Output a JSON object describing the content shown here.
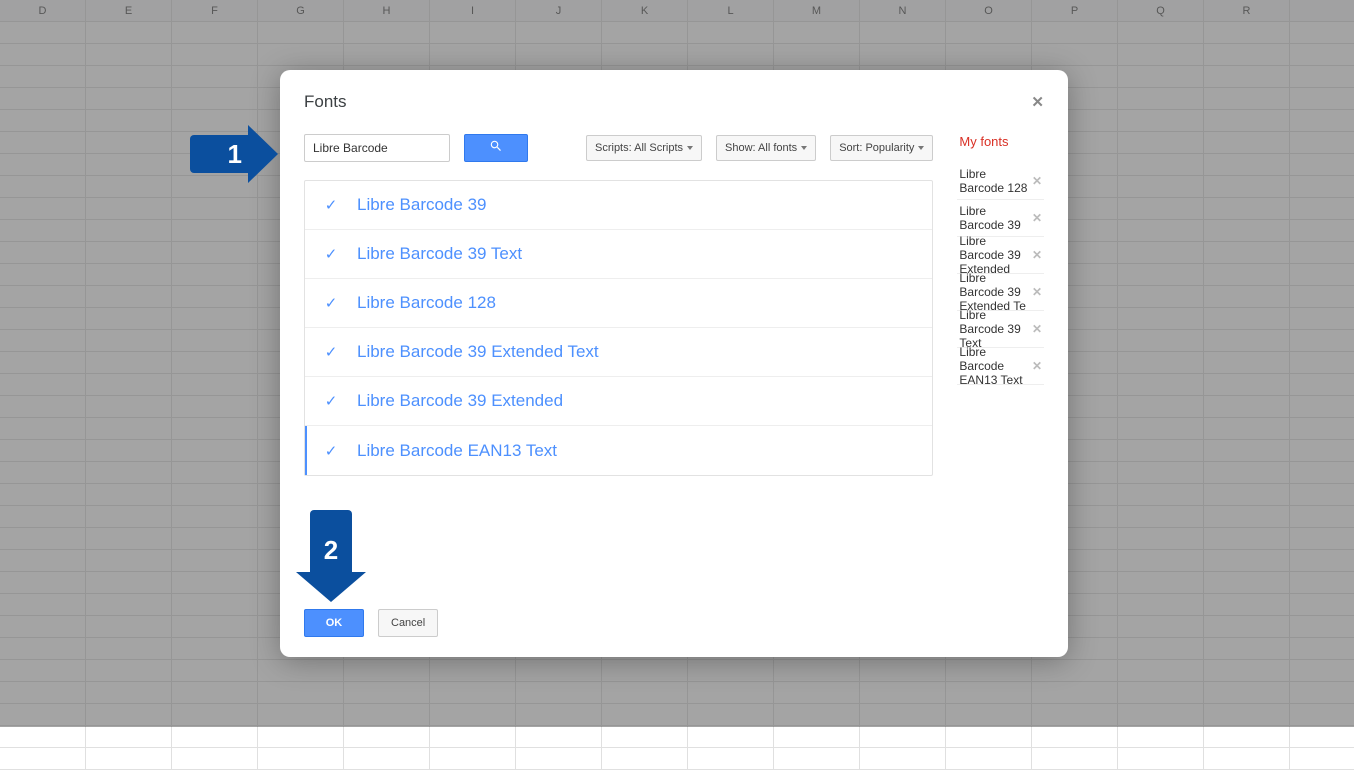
{
  "columns": [
    "D",
    "E",
    "F",
    "G",
    "H",
    "I",
    "J",
    "K",
    "L",
    "M",
    "N",
    "O",
    "P",
    "Q",
    "R"
  ],
  "dialog": {
    "title": "Fonts",
    "search_value": "Libre Barcode",
    "filters": {
      "scripts": "Scripts: All Scripts",
      "show": "Show: All fonts",
      "sort": "Sort: Popularity"
    },
    "results": [
      {
        "name": "Libre Barcode 39",
        "checked": true
      },
      {
        "name": "Libre Barcode 39 Text",
        "checked": true
      },
      {
        "name": "Libre Barcode 128",
        "checked": true
      },
      {
        "name": "Libre Barcode 39 Extended Text",
        "checked": true
      },
      {
        "name": "Libre Barcode 39 Extended",
        "checked": true
      },
      {
        "name": "Libre Barcode EAN13 Text",
        "checked": true,
        "selected": true
      }
    ],
    "myfonts_title": "My fonts",
    "myfonts": [
      "Libre Barcode 128",
      "Libre Barcode 39",
      "Libre Barcode 39 Extended",
      "Libre Barcode 39 Extended Te",
      "Libre Barcode 39 Text",
      "Libre Barcode EAN13 Text"
    ],
    "ok_label": "OK",
    "cancel_label": "Cancel"
  },
  "annotations": {
    "step1": "1",
    "step2": "2"
  }
}
